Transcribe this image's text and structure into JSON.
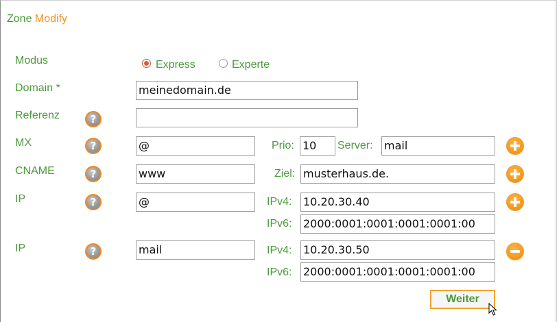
{
  "title": {
    "part1": "Zone",
    "part2": "Modify"
  },
  "modus": {
    "label": "Modus",
    "options": [
      {
        "label": "Express",
        "selected": true
      },
      {
        "label": "Experte",
        "selected": false
      }
    ]
  },
  "domain": {
    "label": "Domain *",
    "value": "meinedomain.de"
  },
  "referenz": {
    "label": "Referenz",
    "value": ""
  },
  "help_icon": "?",
  "mx": {
    "label": "MX",
    "host": "@",
    "prio_label": "Prio:",
    "prio": "10",
    "server_label": "Server:",
    "server": "mail"
  },
  "cname": {
    "label": "CNAME",
    "host": "www",
    "ziel_label": "Ziel:",
    "ziel": "musterhaus.de."
  },
  "ip1": {
    "label": "IP",
    "host": "@",
    "ipv4_label": "IPv4:",
    "ipv4": "10.20.30.40",
    "ipv6_label": "IPv6:",
    "ipv6": "2000:0001:0001:0001:0001:00"
  },
  "ip2": {
    "label": "IP",
    "host": "mail",
    "ipv4_label": "IPv4:",
    "ipv4": "10.20.30.50",
    "ipv6_label": "IPv6:",
    "ipv6": "2000:0001:0001:0001:0001:00"
  },
  "submit_label": "Weiter",
  "colors": {
    "green": "#4a9a3a",
    "orange": "#f0921e"
  }
}
